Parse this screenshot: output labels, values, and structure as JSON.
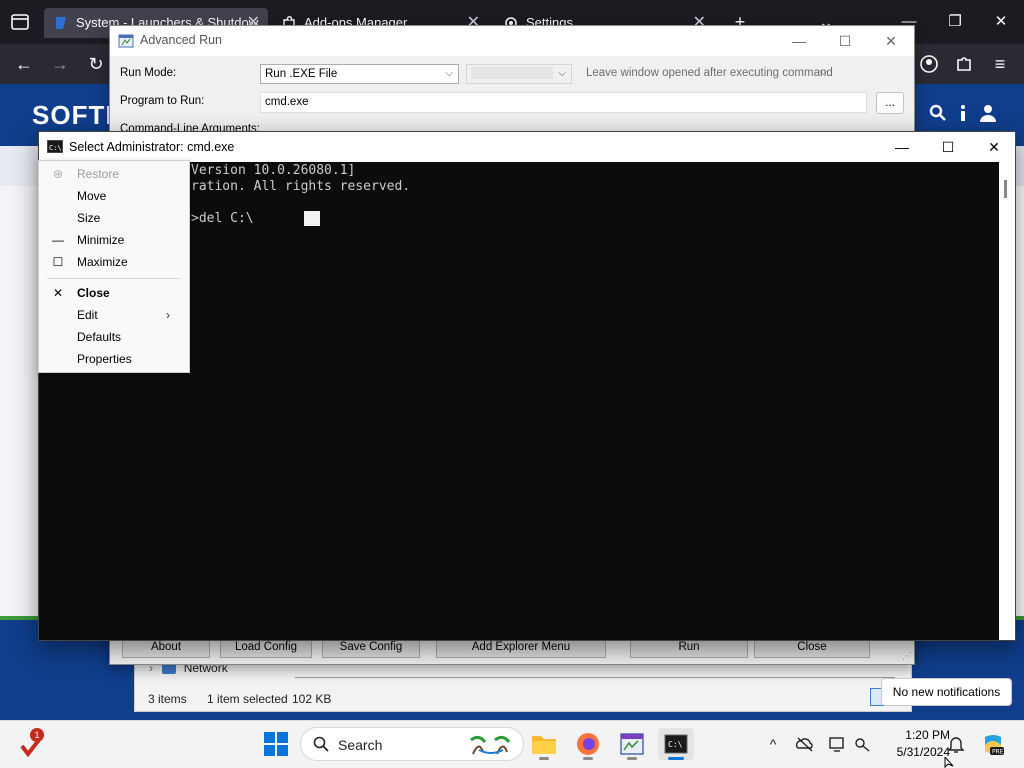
{
  "browser": {
    "tabs": [
      {
        "label": "System - Launchers & Shutdow"
      },
      {
        "label": "Add-ons Manager"
      },
      {
        "label": "Settings"
      }
    ],
    "new_tab": "+",
    "list_all_tabs": "⌄"
  },
  "website": {
    "logo": "SOFTI"
  },
  "explorer": {
    "nav_item": "Network",
    "items_count": "3 items",
    "selected": "1 item selected",
    "size": "102 KB"
  },
  "advanced_run": {
    "title": "Advanced Run",
    "run_mode_label": "Run Mode:",
    "run_mode_value": "Run .EXE File",
    "leave_window_option": "Leave window opened after executing command",
    "program_label": "Program to Run:",
    "program_value": "cmd.exe",
    "browse_label": "...",
    "cmdline_label": "Command-Line Arguments:",
    "buttons": {
      "about": "About",
      "load_config": "Load Config",
      "save_config": "Save Config",
      "add_explorer_menu": "Add Explorer Menu",
      "run": "Run",
      "close": "Close"
    }
  },
  "cmd_window": {
    "title": "Select Administrator: cmd.exe",
    "lines": [
      "Version 10.0.26080.1]",
      "ration. All rights reserved.",
      ">del C:\\"
    ]
  },
  "system_menu": {
    "items": [
      {
        "label": "Restore",
        "enabled": false,
        "icon": "restore-icon"
      },
      {
        "label": "Move",
        "enabled": true
      },
      {
        "label": "Size",
        "enabled": true
      },
      {
        "label": "Minimize",
        "enabled": true,
        "icon": "minimize-icon"
      },
      {
        "label": "Maximize",
        "enabled": true,
        "icon": "maximize-icon"
      },
      {
        "label": "Close",
        "enabled": true,
        "icon": "close-icon"
      },
      {
        "label": "Edit",
        "enabled": true,
        "icon": "submenu-chevron-icon"
      },
      {
        "label": "Defaults",
        "enabled": true
      },
      {
        "label": "Properties",
        "enabled": true
      }
    ]
  },
  "notification": {
    "text": "No new notifications"
  },
  "taskbar": {
    "search_placeholder": "Search",
    "badge_count": "1",
    "time": "1:20 PM",
    "date": "5/31/2024"
  },
  "colors": {
    "site_blue": "#103e8c",
    "site_green": "#3f9a3a",
    "browser_dark": "#1c1b22",
    "cmd_background": "#0c0c0c"
  }
}
